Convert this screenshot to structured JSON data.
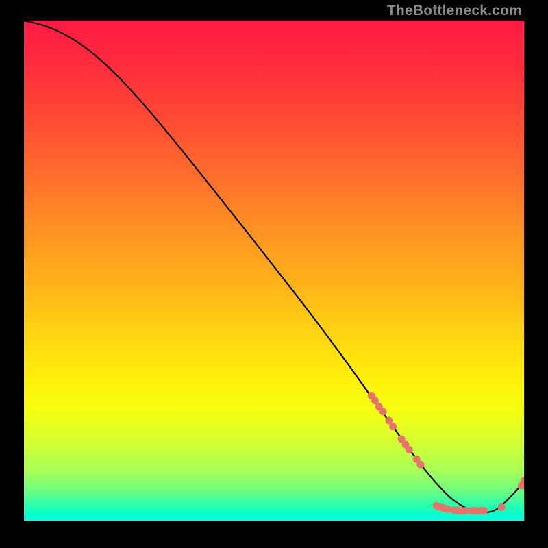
{
  "watermark": "TheBottleneck.com",
  "chart_data": {
    "type": "line",
    "title": "",
    "xlabel": "",
    "ylabel": "",
    "xlim": [
      0,
      100
    ],
    "ylim": [
      0,
      100
    ],
    "grid": false,
    "legend": "none",
    "series": [
      {
        "name": "bottleneck-curve",
        "color": "#000000",
        "x": [
          0,
          4,
          8,
          12,
          16,
          20,
          25,
          30,
          35,
          40,
          45,
          50,
          55,
          60,
          65,
          70,
          74,
          78,
          82,
          86,
          90,
          94,
          98,
          100
        ],
        "y": [
          100,
          99.0,
          97.3,
          94.8,
          91.5,
          87.6,
          82.0,
          76.0,
          69.8,
          63.5,
          57.2,
          50.8,
          44.4,
          37.8,
          31.0,
          24.0,
          18.5,
          13.0,
          8.0,
          4.0,
          2.0,
          2.0,
          5.5,
          8.0
        ]
      }
    ],
    "scatter_points": {
      "name": "highlight-dots",
      "color": "#e6746b",
      "points": [
        {
          "x": 69.5,
          "y": 25.0
        },
        {
          "x": 70.2,
          "y": 24.0
        },
        {
          "x": 71.0,
          "y": 22.8
        },
        {
          "x": 71.8,
          "y": 21.8
        },
        {
          "x": 73.0,
          "y": 20.0
        },
        {
          "x": 73.8,
          "y": 18.8
        },
        {
          "x": 75.5,
          "y": 16.3
        },
        {
          "x": 76.3,
          "y": 15.2
        },
        {
          "x": 77.0,
          "y": 14.2
        },
        {
          "x": 78.5,
          "y": 12.3
        },
        {
          "x": 79.3,
          "y": 11.2
        },
        {
          "x": 82.5,
          "y": 3.0
        },
        {
          "x": 83.3,
          "y": 2.7
        },
        {
          "x": 84.0,
          "y": 2.5
        },
        {
          "x": 84.8,
          "y": 2.3
        },
        {
          "x": 86.0,
          "y": 2.1
        },
        {
          "x": 86.8,
          "y": 2.0
        },
        {
          "x": 87.5,
          "y": 2.0
        },
        {
          "x": 88.3,
          "y": 2.0
        },
        {
          "x": 89.5,
          "y": 2.0
        },
        {
          "x": 90.3,
          "y": 2.0
        },
        {
          "x": 91.3,
          "y": 2.0
        },
        {
          "x": 92.0,
          "y": 2.0
        },
        {
          "x": 95.5,
          "y": 2.7
        },
        {
          "x": 99.5,
          "y": 7.0
        },
        {
          "x": 100.0,
          "y": 8.0
        }
      ]
    }
  }
}
